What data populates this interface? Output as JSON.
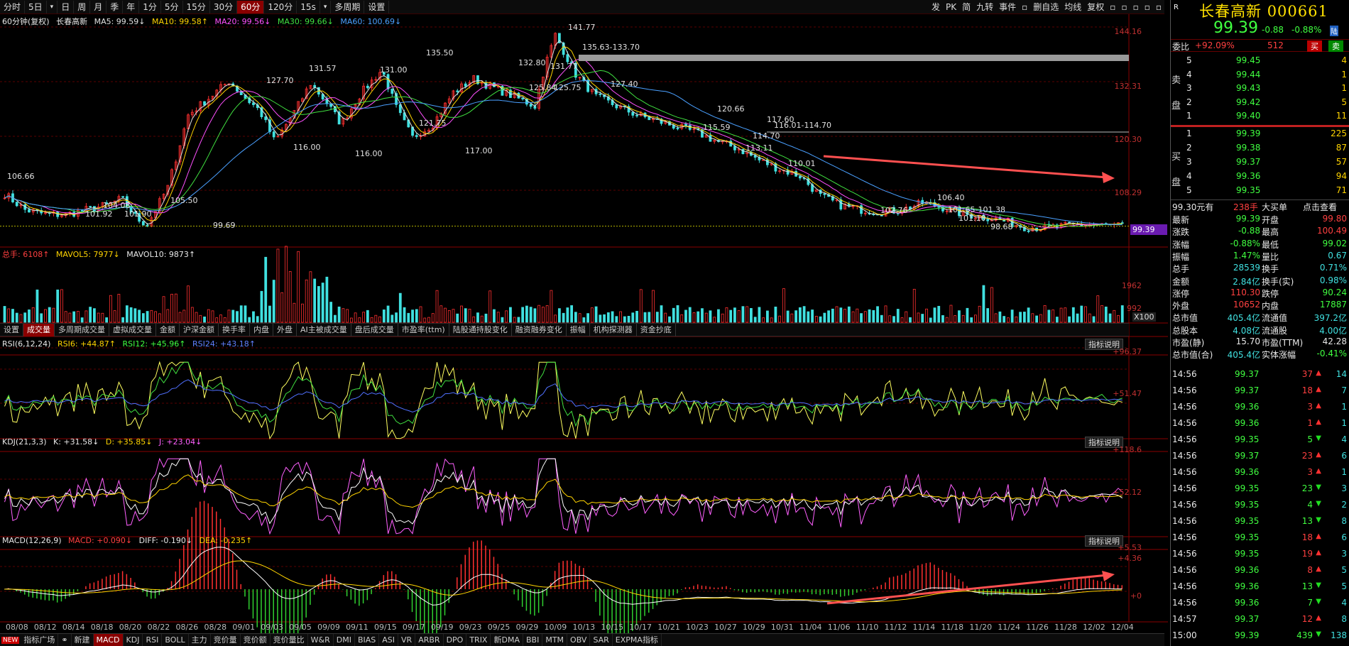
{
  "topbar": {
    "left_items": [
      "分时",
      "5日",
      "",
      "日",
      "周",
      "月",
      "季",
      "年",
      "1分",
      "5分",
      "15分",
      "30分",
      "60分",
      "120分",
      "15s",
      "",
      "多周期",
      "设置"
    ],
    "active_index": 12,
    "right_items": [
      "发",
      "PK",
      "简",
      "九转",
      "事件",
      "",
      "删自选",
      "均线",
      "复权",
      "",
      "",
      "",
      "",
      ""
    ]
  },
  "price_panel": {
    "legend": {
      "period": "60分钟(复权)",
      "name": "长春高新",
      "ma5": "MA5: 99.59↓",
      "ma10": "MA10: 99.58↑",
      "ma20": "MA20: 99.56↓",
      "ma30": "MA30: 99.66↓",
      "ma60": "MA60: 100.69↓"
    },
    "axis_labels": [
      "144.16",
      "132.31",
      "120.30",
      "108.29"
    ],
    "current_price_tag": "99.39",
    "annotations": [
      "141.77",
      "135.63-133.70",
      "135.50",
      "132.80",
      "131.77",
      "131.57",
      "131.00",
      "127.70",
      "127.40",
      "125.84",
      "125.75",
      "121.75",
      "120.66",
      "117.60",
      "117.00",
      "116.00",
      "116.00",
      "116.01-114.70",
      "115.59",
      "114.70",
      "113.11",
      "110.01",
      "106.66",
      "106.40",
      "105.50",
      "104.08",
      "102.76",
      "101.92",
      "101.90",
      "101.65-101.38",
      "101.10",
      "99.69",
      "98.68"
    ]
  },
  "volume_panel": {
    "legend": {
      "total": "总手: 6108↑",
      "mavol5": "MAVOL5: 7977↓",
      "mavol10": "MAVOL10: 9873↑"
    },
    "axis_labels": [
      "1962",
      "992"
    ],
    "unit": "X100"
  },
  "volume_tabs": [
    "设置",
    "成交量",
    "多周期成交量",
    "虚拟成交量",
    "金额",
    "沪深金额",
    "换手率",
    "内盘",
    "外盘",
    "AI主被成交量",
    "盘后成交量",
    "市盈率(ttm)",
    "陆股通持股变化",
    "融资融券变化",
    "振幅",
    "机构探测器",
    "资金抄底"
  ],
  "volume_tab_active": 1,
  "rsi_panel": {
    "legend": {
      "name": "RSI(6,12,24)",
      "rsi6": "RSI6: +44.87↑",
      "rsi12": "RSI12: +45.96↑",
      "rsi24": "RSI24: +43.18↑"
    },
    "axis_labels": [
      "+96.37",
      "+51.47"
    ],
    "explain": "指标说明"
  },
  "kdj_panel": {
    "legend": {
      "name": "KDJ(21,3,3)",
      "k": "K: +31.58↓",
      "d": "D: +35.85↓",
      "j": "J: +23.04↓"
    },
    "axis_labels": [
      "+118.6",
      "+52.12"
    ],
    "explain": "指标说明"
  },
  "macd_panel": {
    "legend": {
      "name": "MACD(12,26,9)",
      "macd": "MACD: +0.090↓",
      "diff": "DIFF: -0.190↓",
      "dea": "DEA: -0.235↑"
    },
    "axis_labels": [
      "+5.53",
      "+4.36",
      "+0"
    ],
    "explain": "指标说明"
  },
  "dates": [
    "08/08",
    "08/12",
    "08/14",
    "08/18",
    "08/20",
    "08/22",
    "08/26",
    "08/28",
    "09/01",
    "09/03",
    "09/05",
    "09/09",
    "09/11",
    "09/15",
    "09/17",
    "09/19",
    "09/23",
    "09/25",
    "09/29",
    "10/09",
    "10/13",
    "10/15",
    "10/17",
    "10/21",
    "10/23",
    "10/27",
    "10/29",
    "10/31",
    "11/04",
    "11/06",
    "11/10",
    "11/12",
    "11/14",
    "11/18",
    "11/20",
    "11/24",
    "11/26",
    "11/28",
    "12/02",
    "12/04"
  ],
  "bottombar": {
    "items": [
      "",
      "指标广场",
      "",
      "新建",
      "MACD",
      "KDJ",
      "RSI",
      "BOLL",
      "主力",
      "竞价量",
      "竞价额",
      "竞价量比",
      "W&R",
      "DMI",
      "BIAS",
      "ASI",
      "VR",
      "ARBR",
      "DPO",
      "TRIX",
      "新DMA",
      "BBI",
      "MTM",
      "OBV",
      "SAR",
      "EXPMA指标"
    ],
    "new_badge": "NEW",
    "active_index": 4
  },
  "quote": {
    "r_label": "R",
    "name": "长春高新",
    "code": "000661",
    "price": "99.39",
    "change": "-0.88",
    "change_pct": "-0.88%",
    "flag": "陆",
    "weibi_label": "委比",
    "weibi_value": "+92.09%",
    "weibi_diff": "512",
    "buy_btn": "买",
    "sell_btn": "卖",
    "sell_label": [
      "卖",
      "盘"
    ],
    "buy_label": [
      "买",
      "盘"
    ],
    "asks": [
      {
        "lvl": "5",
        "price": "99.45",
        "vol": "4"
      },
      {
        "lvl": "4",
        "price": "99.44",
        "vol": "1"
      },
      {
        "lvl": "3",
        "price": "99.43",
        "vol": "1"
      },
      {
        "lvl": "2",
        "price": "99.42",
        "vol": "5"
      },
      {
        "lvl": "1",
        "price": "99.40",
        "vol": "11"
      }
    ],
    "bids": [
      {
        "lvl": "1",
        "price": "99.39",
        "vol": "225"
      },
      {
        "lvl": "2",
        "price": "99.38",
        "vol": "87"
      },
      {
        "lvl": "3",
        "price": "99.37",
        "vol": "57"
      },
      {
        "lvl": "4",
        "price": "99.36",
        "vol": "94"
      },
      {
        "lvl": "5",
        "price": "99.35",
        "vol": "71"
      }
    ],
    "bigorder": {
      "price": "99.30元有",
      "hands": "238手",
      "label": "大买单",
      "link": "点击查看"
    },
    "stats": [
      [
        "最新",
        "99.39",
        "开盘",
        "99.80"
      ],
      [
        "涨跌",
        "-0.88",
        "最高",
        "100.49"
      ],
      [
        "涨幅",
        "-0.88%",
        "最低",
        "99.02"
      ],
      [
        "振幅",
        "1.47%",
        "量比",
        "0.67"
      ],
      [
        "总手",
        "28539",
        "换手",
        "0.71%"
      ],
      [
        "金额",
        "2.84亿",
        "换手(实)",
        "0.98%"
      ],
      [
        "涨停",
        "110.30",
        "跌停",
        "90.24"
      ],
      [
        "外盘",
        "10652",
        "内盘",
        "17887"
      ],
      [
        "总市值",
        "405.4亿",
        "流通值",
        "397.2亿"
      ],
      [
        "总股本",
        "4.08亿",
        "流通股",
        "4.00亿"
      ],
      [
        "市盈(静)",
        "15.70",
        "市盈(TTM)",
        "42.28"
      ],
      [
        "总市值(合)",
        "405.4亿",
        "实体涨幅",
        "-0.41%"
      ]
    ],
    "ticks": [
      {
        "t": "14:56",
        "p": "99.37",
        "v": "37",
        "d": "up",
        "n": "14"
      },
      {
        "t": "14:56",
        "p": "99.37",
        "v": "18",
        "d": "up",
        "n": "7"
      },
      {
        "t": "14:56",
        "p": "99.36",
        "v": "3",
        "d": "up",
        "n": "1"
      },
      {
        "t": "14:56",
        "p": "99.36",
        "v": "1",
        "d": "up",
        "n": "1"
      },
      {
        "t": "14:56",
        "p": "99.35",
        "v": "5",
        "d": "down",
        "n": "4"
      },
      {
        "t": "14:56",
        "p": "99.37",
        "v": "23",
        "d": "up",
        "n": "6"
      },
      {
        "t": "14:56",
        "p": "99.36",
        "v": "3",
        "d": "up",
        "n": "1"
      },
      {
        "t": "14:56",
        "p": "99.35",
        "v": "23",
        "d": "down",
        "n": "3"
      },
      {
        "t": "14:56",
        "p": "99.35",
        "v": "4",
        "d": "down",
        "n": "2"
      },
      {
        "t": "14:56",
        "p": "99.35",
        "v": "13",
        "d": "down",
        "n": "8"
      },
      {
        "t": "14:56",
        "p": "99.35",
        "v": "18",
        "d": "up",
        "n": "6"
      },
      {
        "t": "14:56",
        "p": "99.35",
        "v": "19",
        "d": "up",
        "n": "3"
      },
      {
        "t": "14:56",
        "p": "99.36",
        "v": "8",
        "d": "up",
        "n": "5"
      },
      {
        "t": "14:56",
        "p": "99.36",
        "v": "13",
        "d": "down",
        "n": "5"
      },
      {
        "t": "14:56",
        "p": "99.36",
        "v": "7",
        "d": "down",
        "n": "4"
      },
      {
        "t": "14:57",
        "p": "99.37",
        "v": "12",
        "d": "up",
        "n": "8"
      },
      {
        "t": "15:00",
        "p": "99.39",
        "v": "439",
        "d": "down",
        "n": "138"
      }
    ]
  }
}
